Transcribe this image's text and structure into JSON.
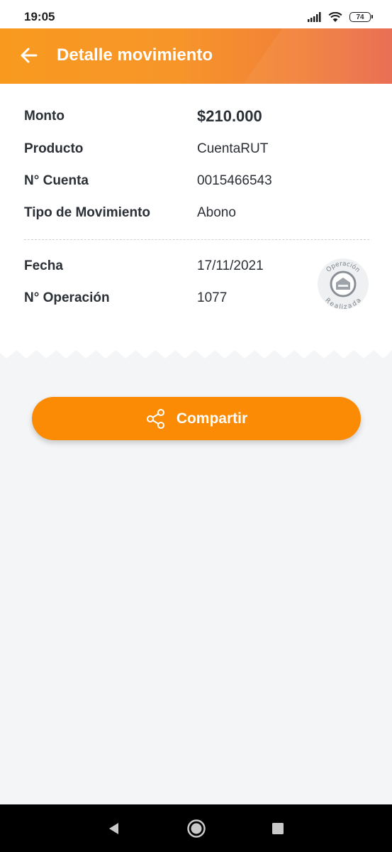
{
  "status_bar": {
    "time": "19:05",
    "battery_level": "74",
    "icons": [
      "signal-icon",
      "wifi-icon",
      "battery-icon"
    ]
  },
  "header": {
    "title": "Detalle movimiento",
    "back_icon": "arrow-left-icon",
    "colors": {
      "start": "#f99a1f",
      "end": "#e8674a"
    }
  },
  "details": {
    "rows": [
      {
        "label": "Monto",
        "value": "$210.000"
      },
      {
        "label": "Producto",
        "value": "CuentaRUT"
      },
      {
        "label": "N° Cuenta",
        "value": "0015466543"
      },
      {
        "label": "Tipo de Movimiento",
        "value": "Abono"
      }
    ],
    "meta_rows": [
      {
        "label": "Fecha",
        "value": "17/11/2021"
      },
      {
        "label": "N° Operación",
        "value": "1077"
      }
    ]
  },
  "stamp": {
    "top_text": "Operación",
    "bottom_text": "Realizada"
  },
  "share_button": {
    "label": "Compartir",
    "icon": "share-icon",
    "color": "#fb8b04"
  },
  "nav_bar": {
    "icons": [
      "back-triangle-icon",
      "home-circle-icon",
      "recents-square-icon"
    ]
  }
}
